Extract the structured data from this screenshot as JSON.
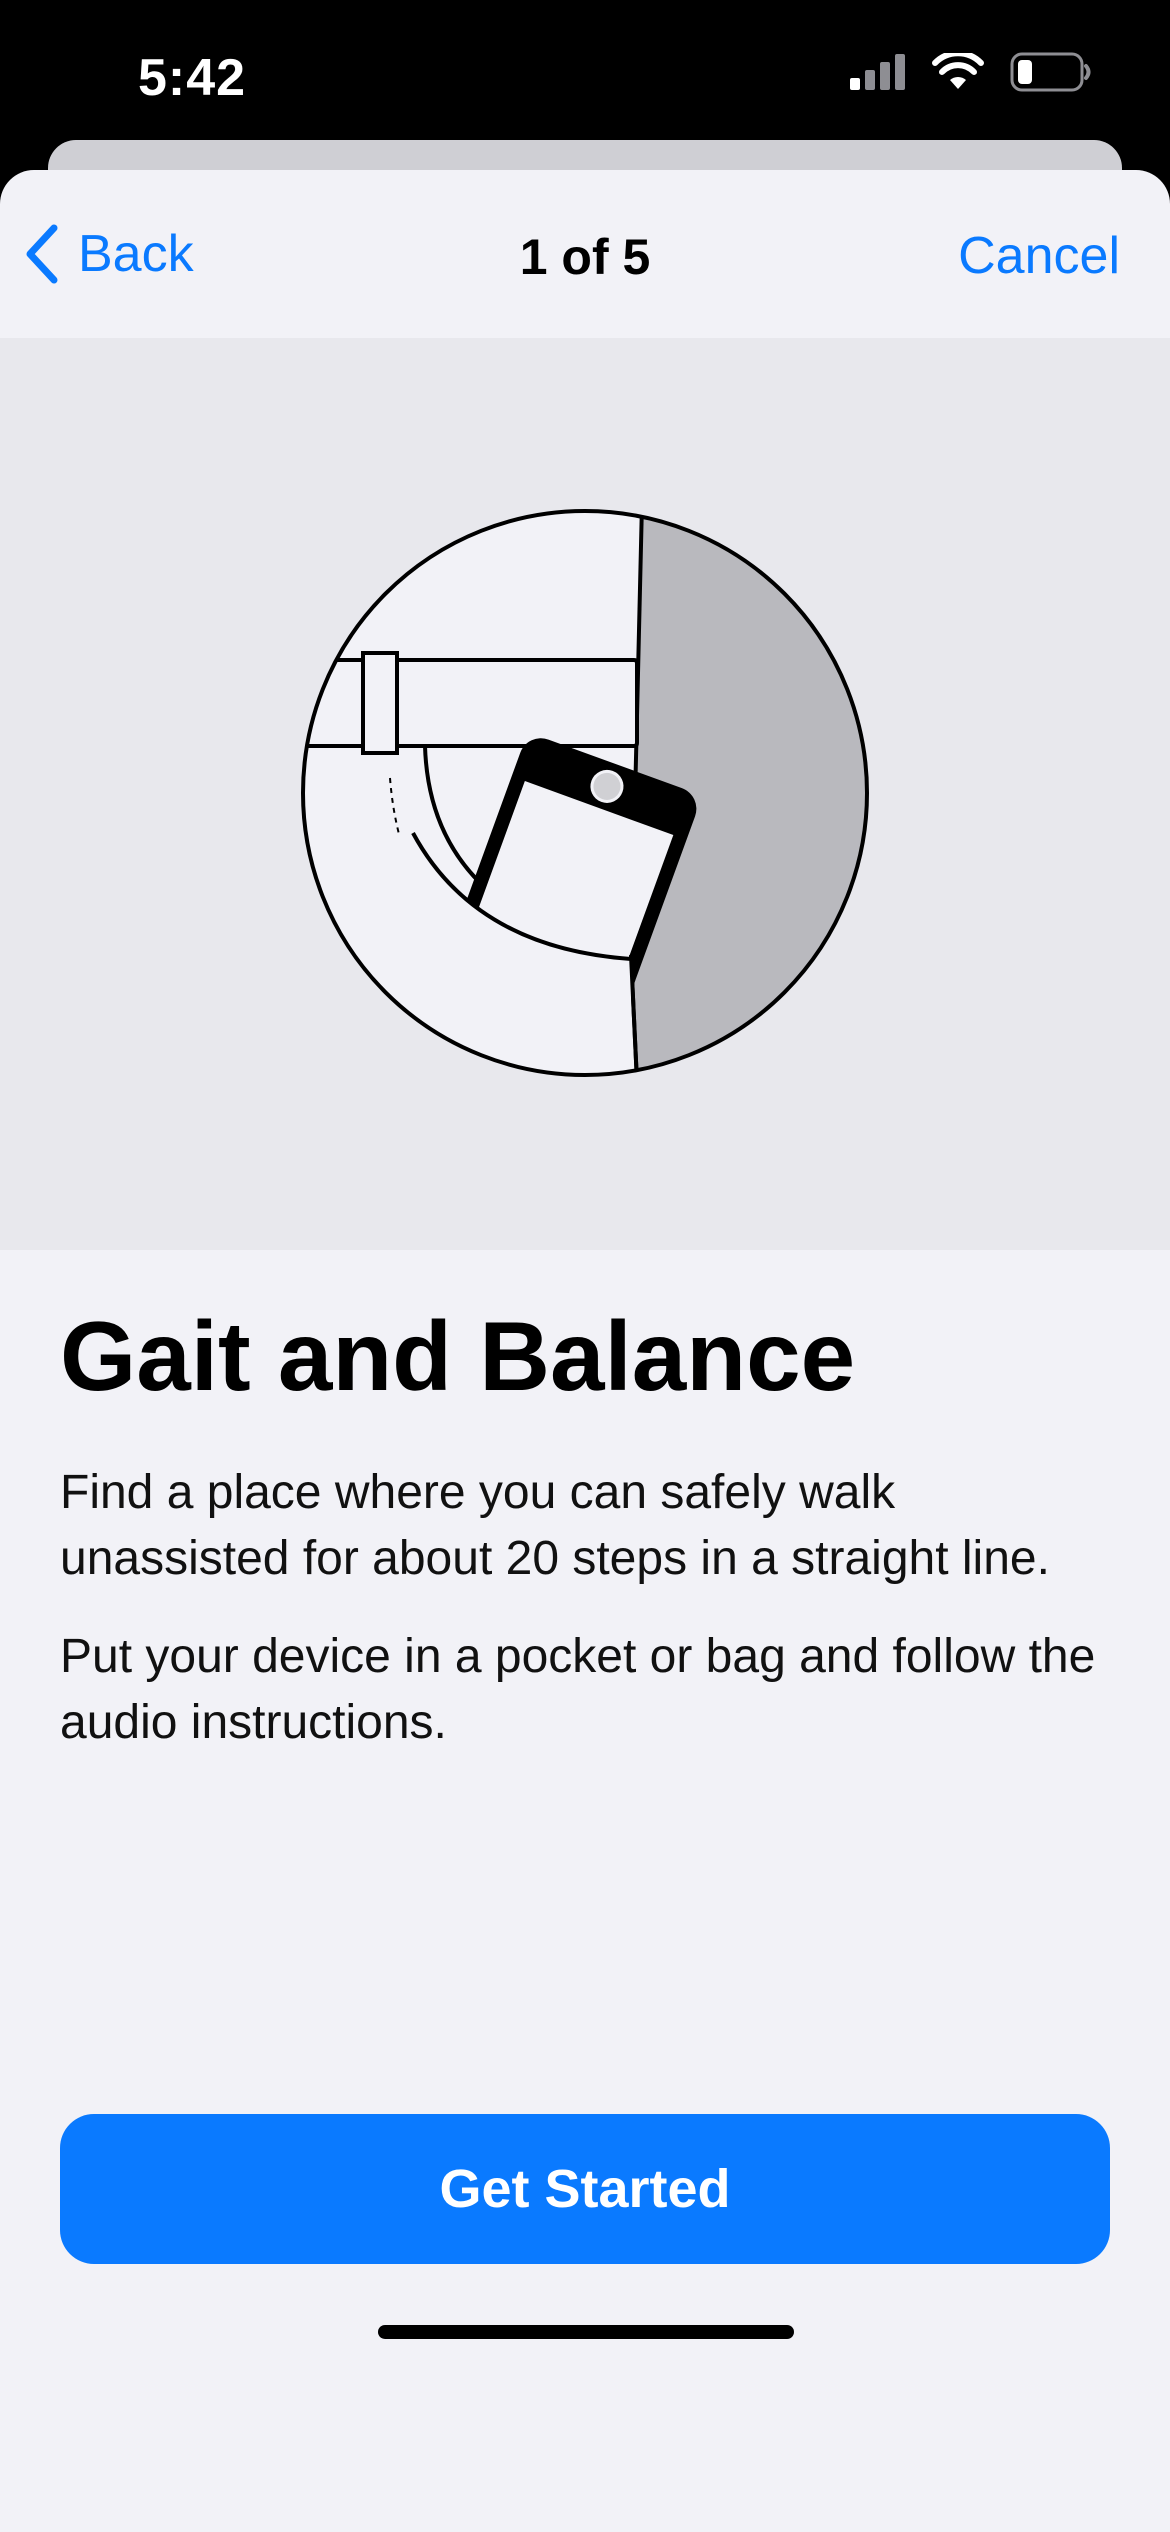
{
  "status_bar": {
    "time": "5:42",
    "icons": [
      "cellular-signal-icon",
      "wifi-icon",
      "battery-icon"
    ]
  },
  "nav": {
    "back_label": "Back",
    "title": "1 of 5",
    "cancel_label": "Cancel"
  },
  "illustration": {
    "icon": "phone-in-pocket-icon"
  },
  "content": {
    "title": "Gait and Balance",
    "paragraphs": [
      "Find a place where you can safely walk unassisted for about 20 steps in a straight line.",
      "Put your device in a pocket or bag and follow the audio instructions."
    ]
  },
  "primary_button": {
    "label": "Get Started"
  },
  "colors": {
    "accent": "#0A7AFF",
    "background": "#F2F2F7",
    "illustration_background": "#E8E8ED"
  }
}
